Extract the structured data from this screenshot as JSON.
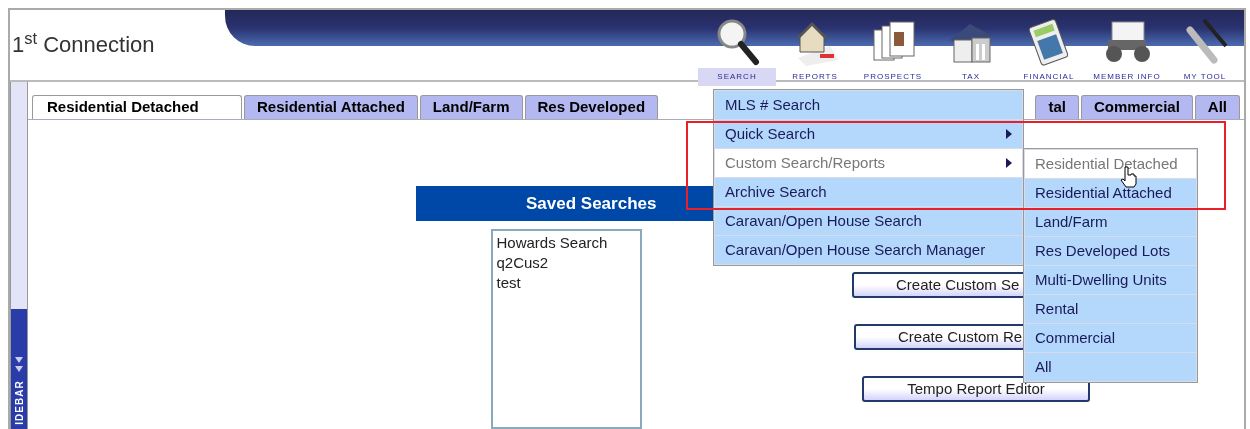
{
  "logo": "1$^{st}$ Connection",
  "nav": [
    {
      "label": "SEARCH",
      "selected": true
    },
    {
      "label": "REPORTS",
      "selected": false
    },
    {
      "label": "PROSPECTS",
      "selected": false
    },
    {
      "label": "TAX",
      "selected": false
    },
    {
      "label": "FINANCIAL",
      "selected": false
    },
    {
      "label": "MEMBER INFO",
      "selected": false
    },
    {
      "label": "MY TOOL",
      "selected": false
    }
  ],
  "sidebar": {
    "label": "IDEBAR"
  },
  "tabs": [
    {
      "label": "Residential Detached",
      "selected": true
    },
    {
      "label": "Residential Attached",
      "selected": false
    },
    {
      "label": "Land/Farm",
      "selected": false
    },
    {
      "label": "Res Developed",
      "selected": false
    },
    {
      "label": "tal",
      "selected": false
    },
    {
      "label": "Commercial",
      "selected": false
    },
    {
      "label": "All",
      "selected": false
    }
  ],
  "saved_searches": {
    "title": "Saved Searches",
    "items": [
      "Howards Search",
      "q2Cus2",
      "test"
    ]
  },
  "buttons": [
    "Create Custom Se",
    "Create Custom Re",
    "Tempo Report Editor"
  ],
  "menu": {
    "items": [
      {
        "label": "MLS # Search",
        "has_submenu": false,
        "highlighted": false
      },
      {
        "label": "Quick Search",
        "has_submenu": true,
        "highlighted": false
      },
      {
        "label": "Custom Search/Reports",
        "has_submenu": true,
        "highlighted": true
      },
      {
        "label": "Archive Search",
        "has_submenu": false,
        "highlighted": false
      },
      {
        "label": "Caravan/Open House Search",
        "has_submenu": false,
        "highlighted": false
      },
      {
        "label": "Caravan/Open House Search Manager",
        "has_submenu": false,
        "highlighted": false
      }
    ]
  },
  "submenu": {
    "items": [
      {
        "label": "Residential Detached",
        "highlighted": true
      },
      {
        "label": "Residential Attached",
        "highlighted": false
      },
      {
        "label": "Land/Farm",
        "highlighted": false
      },
      {
        "label": "Res Developed Lots",
        "highlighted": false
      },
      {
        "label": "Multi-Dwelling Units",
        "highlighted": false
      },
      {
        "label": "Rental",
        "highlighted": false
      },
      {
        "label": "Commercial",
        "highlighted": false
      },
      {
        "label": "All",
        "highlighted": false
      }
    ]
  }
}
